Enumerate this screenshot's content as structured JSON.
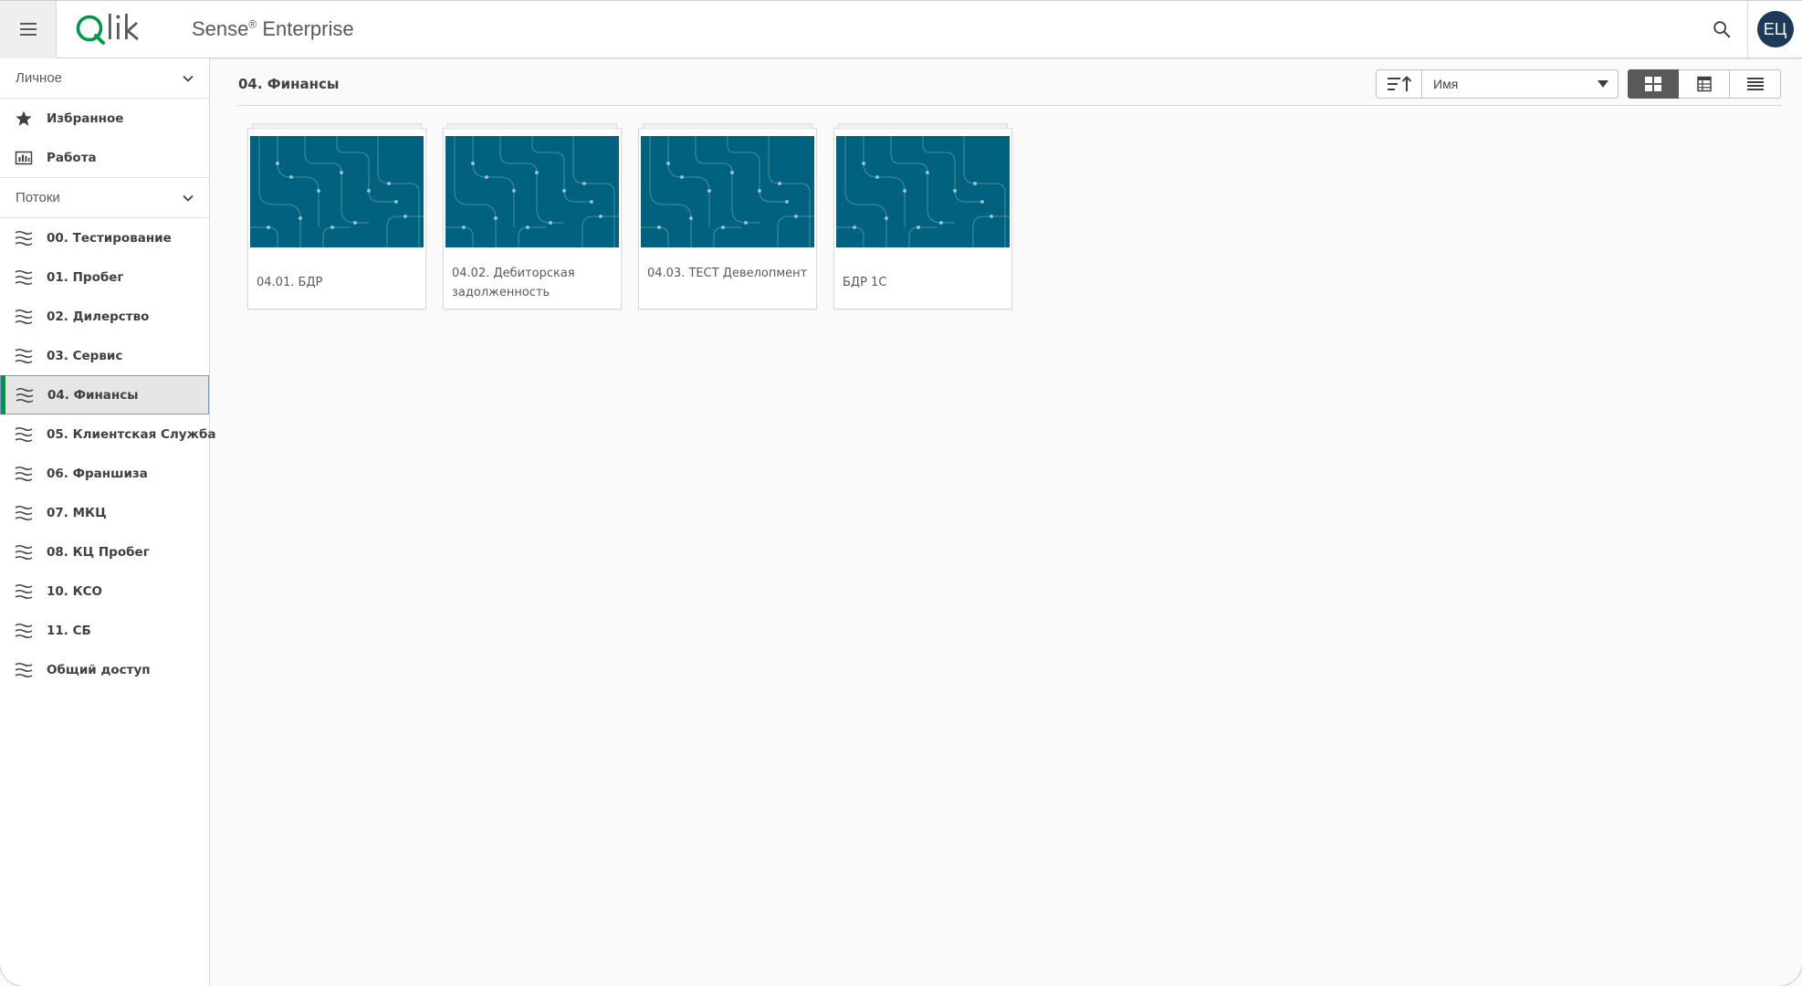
{
  "header": {
    "product_name": "Sense",
    "product_mark": "®",
    "product_edition": " Enterprise",
    "avatar_initials": "ЕЦ"
  },
  "sidebar": {
    "personal_label": "Личное",
    "personal_items": [
      {
        "label": "Избранное",
        "icon": "star-icon"
      },
      {
        "label": "Работа",
        "icon": "work-icon"
      }
    ],
    "streams_label": "Потоки",
    "streams": [
      {
        "label": "00. Тестирование"
      },
      {
        "label": "01. Пробег"
      },
      {
        "label": "02. Дилерство"
      },
      {
        "label": "03. Сервис"
      },
      {
        "label": "04. Финансы",
        "active": true
      },
      {
        "label": "05. Клиентская Служба"
      },
      {
        "label": "06. Франшиза"
      },
      {
        "label": "07. МКЦ"
      },
      {
        "label": "08. КЦ Пробег"
      },
      {
        "label": "10. КСО"
      },
      {
        "label": "11. СБ"
      },
      {
        "label": "Общий доступ"
      }
    ]
  },
  "main": {
    "stream_title": "04. Финансы",
    "sort_value": "Имя",
    "view_modes": [
      "grid-view",
      "table-view",
      "list-view"
    ],
    "active_view": "grid-view",
    "apps": [
      {
        "title": "04.01. БДР"
      },
      {
        "title": "04.02. Дебиторская задолженность"
      },
      {
        "title": "04.03. ТЕСТ Девелопмент"
      },
      {
        "title": "БДР 1С"
      }
    ]
  },
  "colors": {
    "accent_green": "#009845",
    "thumbnail": "#00627f",
    "avatar": "#1d3a5a"
  }
}
